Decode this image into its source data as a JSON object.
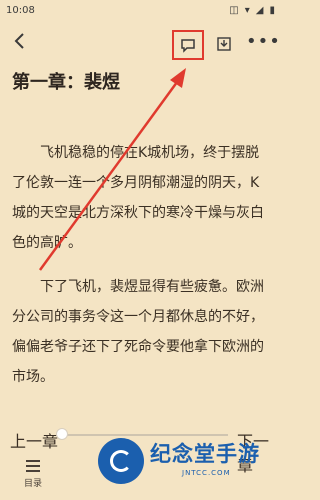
{
  "status": {
    "time": "10:08"
  },
  "colors": {
    "background": "#f4e4c4",
    "highlight": "#e03a2e",
    "watermark": "#1b5fae"
  },
  "toolbar": {
    "back_icon": "chevron-left-icon",
    "comment_icon": "comment-icon",
    "download_icon": "download-icon",
    "more_label": "•••"
  },
  "chapter": {
    "title": "第一章：裴煜"
  },
  "paragraphs": [
    "飞机稳稳的停在K城机场，终于摆脱了伦敦一连一个多月阴郁潮湿的阴天，K城的天空是北方深秋下的寒冷干燥与灰白色的高旷。",
    "下了飞机，裴煜显得有些疲惫。欧洲分公司的事务令这一个月都休息的不好，偏偏老爷子还下了死命令要他拿下欧洲的市场。"
  ],
  "bottom": {
    "prev_label": "上一章",
    "next_label": "下一章",
    "toc_label": "目录",
    "progress": 0.0
  },
  "watermark": {
    "name": "纪念堂手游",
    "site": "JNTCC.COM"
  }
}
